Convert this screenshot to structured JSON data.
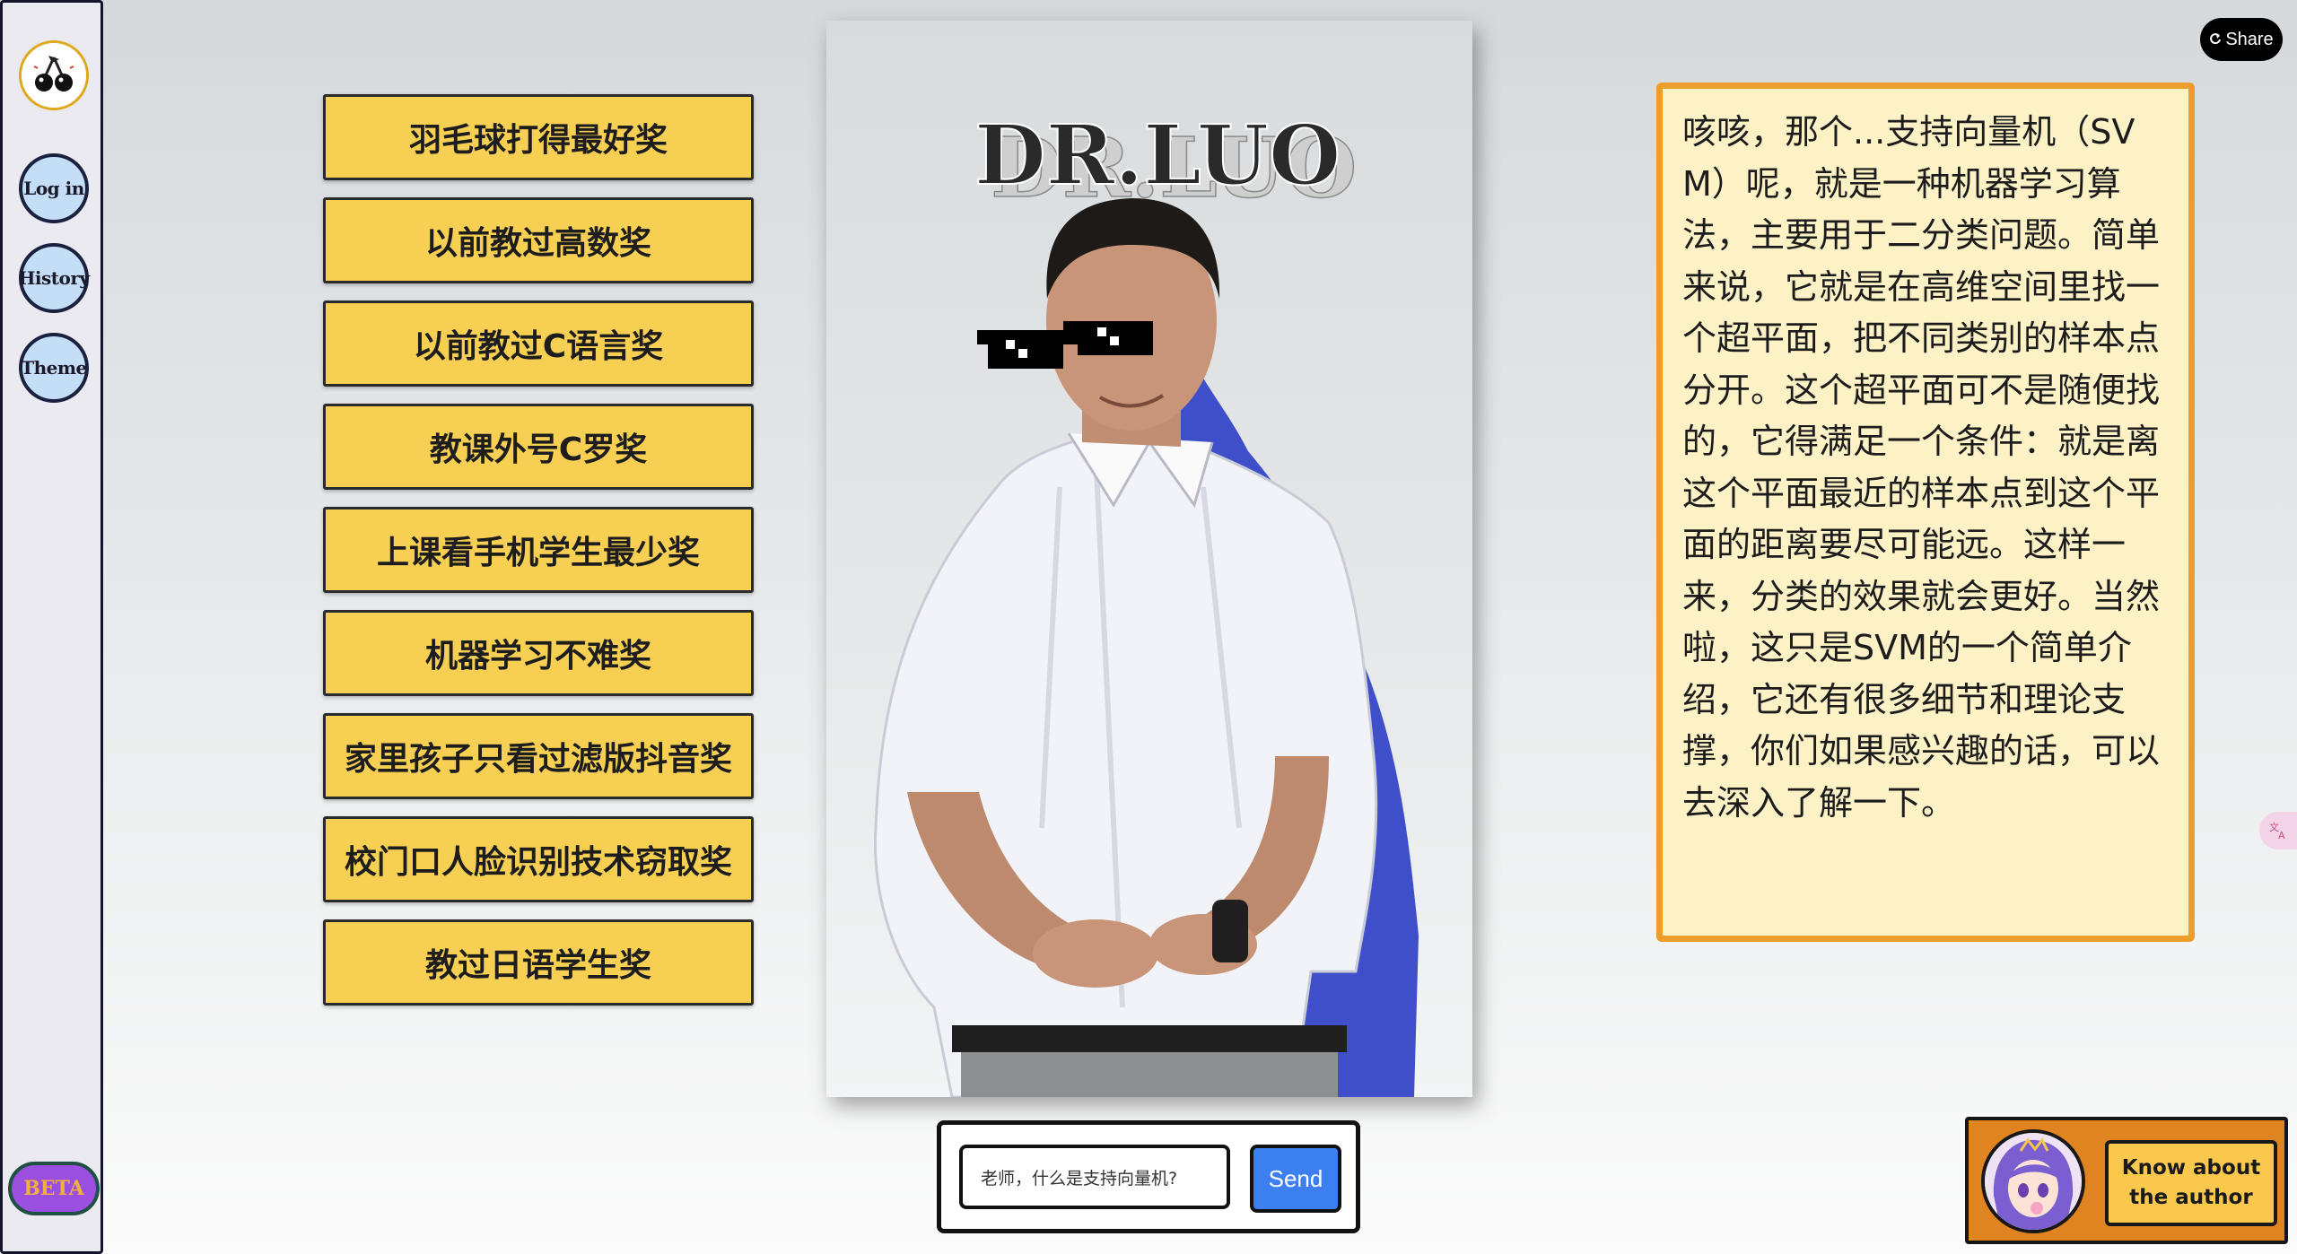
{
  "sidebar": {
    "logo_icon": "cherry-logo-icon",
    "login_label": "Log in",
    "history_label": "History",
    "theme_label": "Theme",
    "beta_label": "BETA"
  },
  "awards": [
    "羽毛球打得最好奖",
    "以前教过高数奖",
    "以前教过C语言奖",
    "教课外号C罗奖",
    "上课看手机学生最少奖",
    "机器学习不难奖",
    "家里孩子只看过滤版抖音奖",
    "校门口人脸识别技术窃取奖",
    "教过日语学生奖"
  ],
  "portrait": {
    "title": "DR.LUO",
    "accent_color": "#3f4fca"
  },
  "chat": {
    "input_value": "老师，什么是支持向量机?",
    "send_label": "Send"
  },
  "answer": {
    "text": "咳咳，那个...支持向量机（SVM）呢，就是一种机器学习算法，主要用于二分类问题。简单来说，它就是在高维空间里找一个超平面，把不同类别的样本点分开。这个超平面可不是随便找的，它得满足一个条件：就是离这个平面最近的样本点到这个平面的距离要尽可能远。这样一来，分类的效果就会更好。当然啦，这只是SVM的一个简单介绍，它还有很多细节和理论支撑，你们如果感兴趣的话，可以去深入了解一下。"
  },
  "share": {
    "label": "Share",
    "icon": "share-icon"
  },
  "author": {
    "button_label": "Know about the author",
    "avatar_icon": "anime-avatar"
  },
  "colors": {
    "award_bg": "#f7cf53",
    "answer_bg": "#fdf1c6",
    "answer_border": "#ed9d2c",
    "send_bg": "#3c7ff0",
    "beta_bg": "#9b4fe0",
    "author_bg": "#df8420"
  }
}
